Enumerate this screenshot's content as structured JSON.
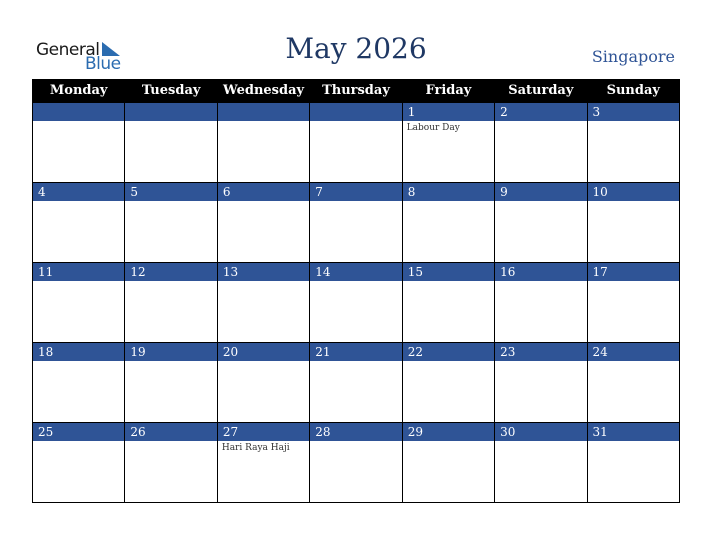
{
  "header": {
    "logo_general": "General",
    "logo_blue": "Blue",
    "title": "May 2026",
    "country": "Singapore"
  },
  "weekdays": [
    "Monday",
    "Tuesday",
    "Wednesday",
    "Thursday",
    "Friday",
    "Saturday",
    "Sunday"
  ],
  "weeks": [
    [
      {
        "day": "",
        "event": ""
      },
      {
        "day": "",
        "event": ""
      },
      {
        "day": "",
        "event": ""
      },
      {
        "day": "",
        "event": ""
      },
      {
        "day": "1",
        "event": "Labour Day"
      },
      {
        "day": "2",
        "event": ""
      },
      {
        "day": "3",
        "event": ""
      }
    ],
    [
      {
        "day": "4",
        "event": ""
      },
      {
        "day": "5",
        "event": ""
      },
      {
        "day": "6",
        "event": ""
      },
      {
        "day": "7",
        "event": ""
      },
      {
        "day": "8",
        "event": ""
      },
      {
        "day": "9",
        "event": ""
      },
      {
        "day": "10",
        "event": ""
      }
    ],
    [
      {
        "day": "11",
        "event": ""
      },
      {
        "day": "12",
        "event": ""
      },
      {
        "day": "13",
        "event": ""
      },
      {
        "day": "14",
        "event": ""
      },
      {
        "day": "15",
        "event": ""
      },
      {
        "day": "16",
        "event": ""
      },
      {
        "day": "17",
        "event": ""
      }
    ],
    [
      {
        "day": "18",
        "event": ""
      },
      {
        "day": "19",
        "event": ""
      },
      {
        "day": "20",
        "event": ""
      },
      {
        "day": "21",
        "event": ""
      },
      {
        "day": "22",
        "event": ""
      },
      {
        "day": "23",
        "event": ""
      },
      {
        "day": "24",
        "event": ""
      }
    ],
    [
      {
        "day": "25",
        "event": ""
      },
      {
        "day": "26",
        "event": ""
      },
      {
        "day": "27",
        "event": "Hari Raya Haji"
      },
      {
        "day": "28",
        "event": ""
      },
      {
        "day": "29",
        "event": ""
      },
      {
        "day": "30",
        "event": ""
      },
      {
        "day": "31",
        "event": ""
      }
    ]
  ]
}
